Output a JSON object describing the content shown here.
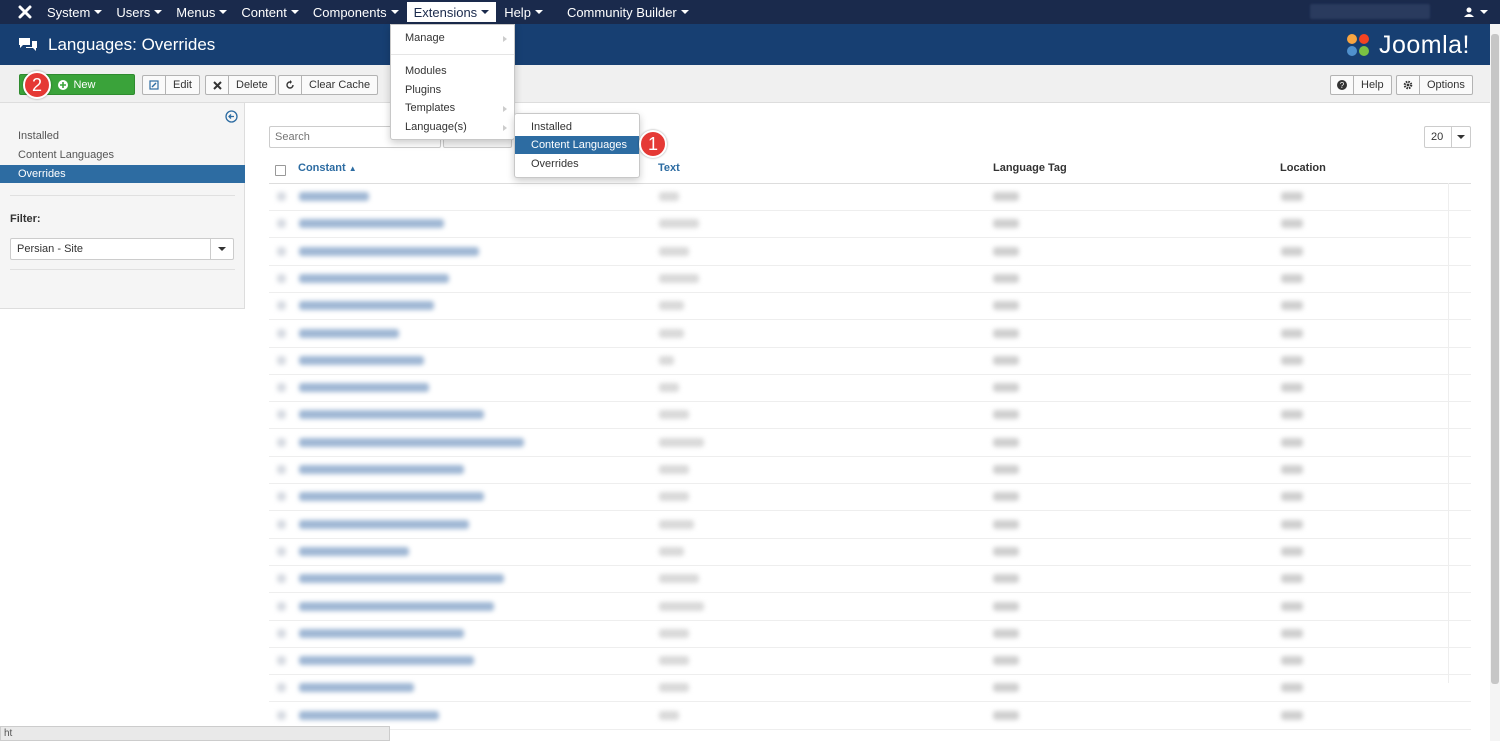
{
  "topnav": {
    "items": [
      {
        "label": "System"
      },
      {
        "label": "Users"
      },
      {
        "label": "Menus"
      },
      {
        "label": "Content"
      },
      {
        "label": "Components"
      },
      {
        "label": "Extensions"
      },
      {
        "label": "Help"
      },
      {
        "label": "Community Builder"
      }
    ]
  },
  "header": {
    "title": "Languages: Overrides",
    "brand": "Joomla!"
  },
  "toolbar": {
    "new_label": "New",
    "edit_label": "Edit",
    "delete_label": "Delete",
    "clear_cache_label": "Clear Cache",
    "help_label": "Help",
    "options_label": "Options"
  },
  "annotations": {
    "badge1": "1",
    "badge2": "2"
  },
  "sidebar": {
    "items": [
      {
        "label": "Installed"
      },
      {
        "label": "Content Languages"
      },
      {
        "label": "Overrides"
      }
    ],
    "filter_label": "Filter:",
    "filter_value": "Persian - Site"
  },
  "search": {
    "placeholder": "Search"
  },
  "limit": {
    "value": "20"
  },
  "table": {
    "columns": [
      "Constant",
      "Text",
      "Language Tag",
      "Location"
    ]
  },
  "extensions_menu": {
    "items": [
      {
        "label": "Manage"
      },
      {
        "label": "Modules"
      },
      {
        "label": "Plugins"
      },
      {
        "label": "Templates"
      },
      {
        "label": "Language(s)"
      }
    ]
  },
  "languages_submenu": {
    "items": [
      {
        "label": "Installed"
      },
      {
        "label": "Content Languages"
      },
      {
        "label": "Overrides"
      }
    ]
  },
  "statusbar": {
    "text": "ht"
  }
}
